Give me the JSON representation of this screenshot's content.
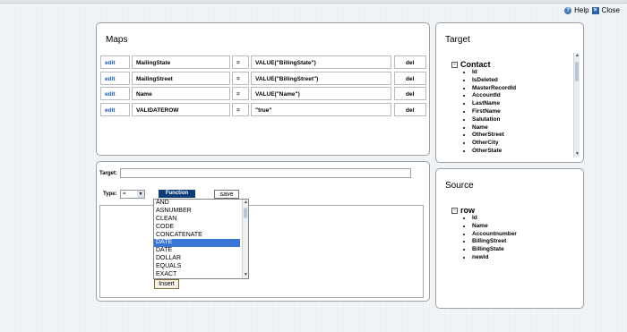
{
  "header": {
    "help_label": "Help",
    "close_label": "Close"
  },
  "maps": {
    "title": "Maps",
    "rows": [
      {
        "edit": "edit",
        "field": "MailingState",
        "op": "=",
        "value": "VALUE(\"BillingState\")",
        "del": "del"
      },
      {
        "edit": "edit",
        "field": "MailingStreet",
        "op": "=",
        "value": "VALUE(\"BillingStreet\")",
        "del": "del"
      },
      {
        "edit": "edit",
        "field": "Name",
        "op": "=",
        "value": "VALUE(\"Name\")",
        "del": "del"
      },
      {
        "edit": "edit",
        "field": "VALIDATEROW",
        "op": "=",
        "value": "\"true\"",
        "del": "del"
      }
    ]
  },
  "target_panel": {
    "title": "Target",
    "root": "Contact",
    "fields": [
      "Id",
      "IsDeleted",
      "MasterRecordId",
      "AccountId",
      "LastName",
      "FirstName",
      "Salutation",
      "Name",
      "OtherStreet",
      "OtherCity",
      "OtherState"
    ]
  },
  "source_panel": {
    "title": "Source",
    "root": "row",
    "fields": [
      "Id",
      "Name",
      "Accountnumber",
      "BillingStreet",
      "BillingState",
      "newid"
    ]
  },
  "editor": {
    "target_label": "Target:",
    "target_value": "",
    "type_label": "Type:",
    "type_value": "=",
    "function_button": "Function",
    "save_button": "save",
    "insert_button": "Insert",
    "functions": [
      "AND",
      "ASNUMBER",
      "CLEAN",
      "CODE",
      "CONCATENATE",
      "DATE",
      "DATE",
      "DOLLAR",
      "EQUALS",
      "EXACT"
    ],
    "selected_function_index": 5
  }
}
